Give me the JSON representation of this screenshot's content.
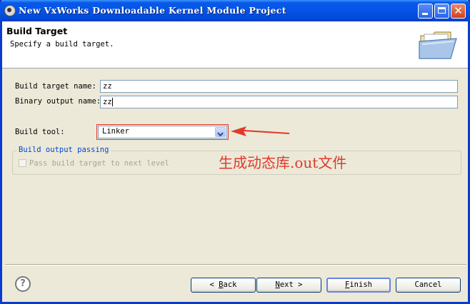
{
  "window": {
    "title": "New VxWorks Downloadable Kernel Module Project",
    "title_bar_color": "#0453e6"
  },
  "header": {
    "page_title": "Build Target",
    "description": "Specify a build target.",
    "icon": "folder-icon"
  },
  "form": {
    "build_target_label": "Build target name:",
    "build_target_value": "zz",
    "binary_output_label": "Binary output name:",
    "binary_output_value": "zz",
    "build_tool_label": "Build tool:",
    "build_tool_value": "Linker"
  },
  "group": {
    "legend": "Build output passing",
    "checkbox_label": "Pass build target to next level",
    "checkbox_checked": false,
    "checkbox_enabled": false
  },
  "annotation": {
    "text": "生成动态库.out文件",
    "color": "#e0392b"
  },
  "buttons": {
    "back": {
      "prefix": "< ",
      "mnemonic": "B",
      "rest": "ack"
    },
    "next": {
      "mnemonic": "N",
      "rest": "ext",
      "suffix": " >"
    },
    "finish": {
      "mnemonic": "F",
      "rest": "inish"
    },
    "cancel": "Cancel"
  }
}
